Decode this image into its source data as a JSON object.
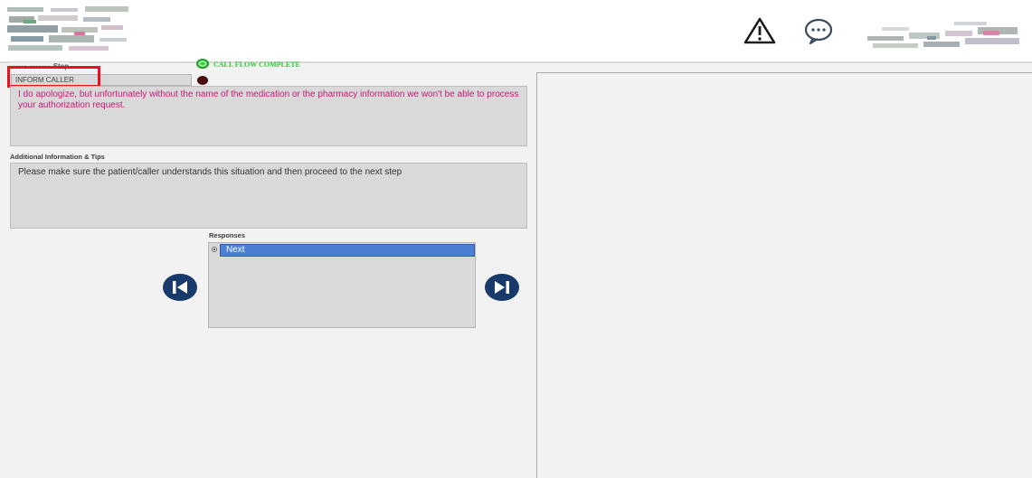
{
  "header": {
    "logo_left": "logo",
    "logo_right": "logo",
    "icons": {
      "warning": "warning-triangle-icon",
      "chat": "chat-bubble-icon"
    }
  },
  "step": {
    "label_visible": "Step",
    "field_value": "INFORM CALLER",
    "flow_status": "CALL FLOW COMPLETE"
  },
  "message": {
    "text": "I do apologize, but unfortunately without the name of the medication or the pharmacy information we won't be able to process your authorization request."
  },
  "tips": {
    "label": "Additional Information & Tips",
    "text": "Please make sure the patient/caller understands this situation and then proceed to the next step"
  },
  "responses": {
    "label": "Responses",
    "items": [
      "Next"
    ]
  },
  "navigation": {
    "prev_icon": "skip-previous-icon",
    "next_icon": "skip-next-icon"
  },
  "colors": {
    "message_text": "#c8187a",
    "flow_complete": "#2fc93a",
    "selection": "#4a7fd4",
    "nav_button": "#173a6a",
    "highlight": "#e6131a"
  }
}
